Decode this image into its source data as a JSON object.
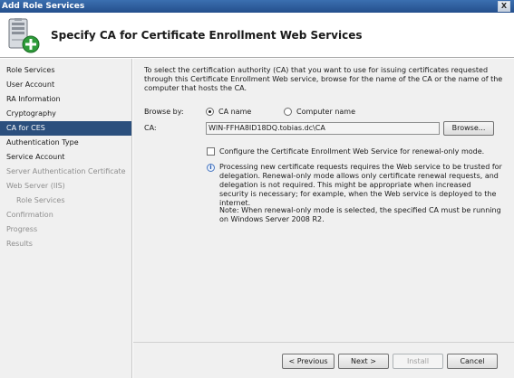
{
  "window": {
    "title": "Add Role Services",
    "close_label": "X"
  },
  "header": {
    "title": "Specify CA for Certificate Enrollment Web Services",
    "icon": "server-add-icon"
  },
  "sidebar": {
    "items": [
      {
        "label": "Role Services",
        "state": "enabled"
      },
      {
        "label": "User Account",
        "state": "enabled"
      },
      {
        "label": "RA Information",
        "state": "enabled"
      },
      {
        "label": "Cryptography",
        "state": "enabled"
      },
      {
        "label": "CA for CES",
        "state": "active"
      },
      {
        "label": "Authentication Type",
        "state": "enabled"
      },
      {
        "label": "Service Account",
        "state": "enabled"
      },
      {
        "label": "Server Authentication Certificate",
        "state": "disabled"
      },
      {
        "label": "Web Server (IIS)",
        "state": "disabled"
      },
      {
        "label": "Role Services",
        "state": "disabled-sub"
      },
      {
        "label": "Confirmation",
        "state": "disabled"
      },
      {
        "label": "Progress",
        "state": "disabled"
      },
      {
        "label": "Results",
        "state": "disabled"
      }
    ]
  },
  "main": {
    "description": "To select the certification authority (CA) that you want to use for issuing certificates requested through this Certificate Enrollment Web service, browse for the name of the CA or the name of the computer that hosts the CA.",
    "browse_by_label": "Browse by:",
    "radio_ca_name": "CA name",
    "radio_computer_name": "Computer name",
    "radio_selected": "CA name",
    "ca_label": "CA:",
    "ca_value": "WIN-FFHA8ID18DQ.tobias.dc\\CA",
    "browse_button": "Browse...",
    "renewal_only_label": "Configure the Certificate Enrollment Web Service for renewal-only mode.",
    "renewal_only_checked": false,
    "info_text": "Processing new certificate requests requires the Web service to be trusted for delegation. Renewal-only mode allows only certificate renewal requests, and delegation is not required. This might be appropriate when increased security is necessary; for example, when the Web service is deployed to the internet.",
    "note_text": "Note: When renewal-only mode is selected, the specified CA must be running on Windows Server 2008 R2."
  },
  "footer": {
    "previous": "< Previous",
    "next": "Next >",
    "install": "Install",
    "cancel": "Cancel"
  }
}
